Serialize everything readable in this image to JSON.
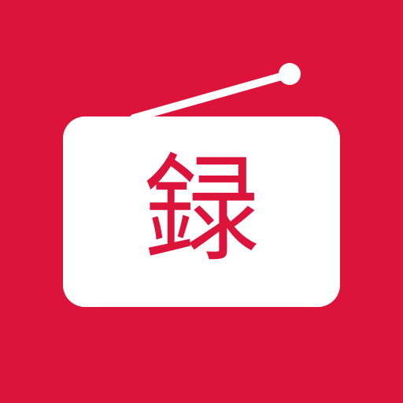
{
  "icon": {
    "glyph": "録",
    "background_color": "#DC143C",
    "body_color": "#FFFFFF",
    "glyph_color": "#DC143C",
    "symbol": "radio-icon"
  }
}
